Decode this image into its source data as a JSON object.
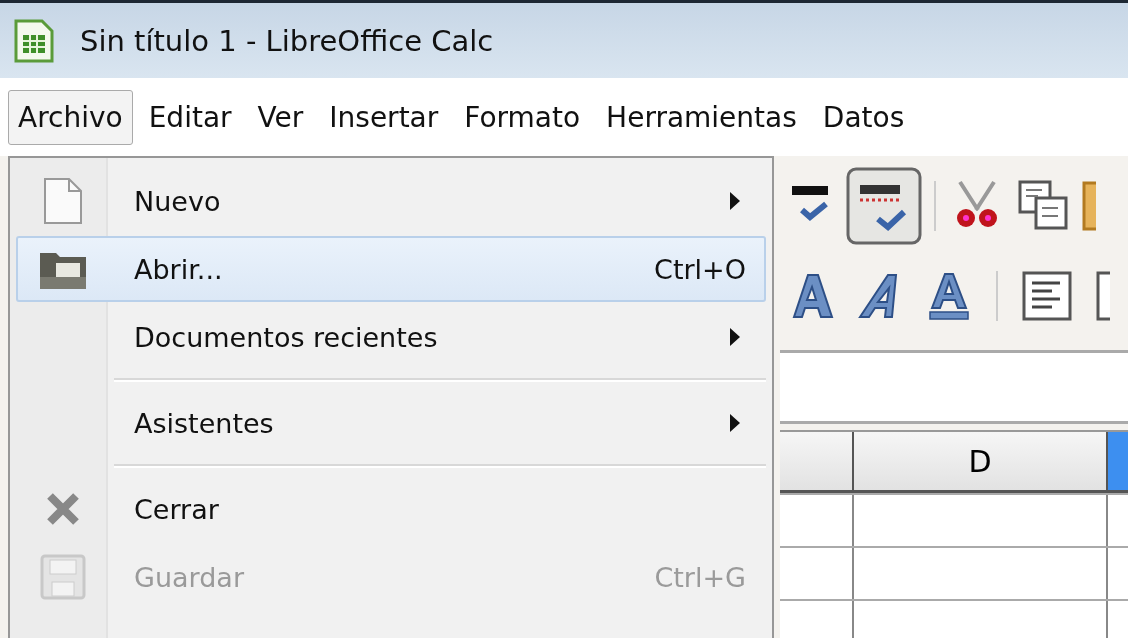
{
  "window": {
    "title": "Sin título 1 - LibreOffice Calc"
  },
  "menubar": [
    {
      "label": "Archivo",
      "selected": true
    },
    {
      "label": "Editar",
      "selected": false
    },
    {
      "label": "Ver",
      "selected": false
    },
    {
      "label": "Insertar",
      "selected": false
    },
    {
      "label": "Formato",
      "selected": false
    },
    {
      "label": "Herramientas",
      "selected": false
    },
    {
      "label": "Datos",
      "selected": false
    }
  ],
  "menu": [
    {
      "kind": "item",
      "label": "Nuevo",
      "submenu": true,
      "selected": false,
      "disabled": false
    },
    {
      "kind": "item",
      "label": "Abrir...",
      "shortcut": "Ctrl+O",
      "submenu": false,
      "selected": true,
      "disabled": false
    },
    {
      "kind": "item",
      "label": "Documentos recientes",
      "submenu": true,
      "selected": false,
      "disabled": false
    },
    {
      "kind": "separator"
    },
    {
      "kind": "item",
      "label": "Asistentes",
      "submenu": true,
      "selected": false,
      "disabled": false
    },
    {
      "kind": "separator"
    },
    {
      "kind": "item",
      "label": "Cerrar",
      "submenu": false,
      "selected": false,
      "disabled": false
    },
    {
      "kind": "item",
      "label": "Guardar",
      "shortcut": "Ctrl+G",
      "submenu": false,
      "selected": false,
      "disabled": true
    }
  ],
  "toolbar": {
    "autospellcheck_on": true
  },
  "sheet": {
    "columns": [
      {
        "label": "D"
      }
    ]
  }
}
